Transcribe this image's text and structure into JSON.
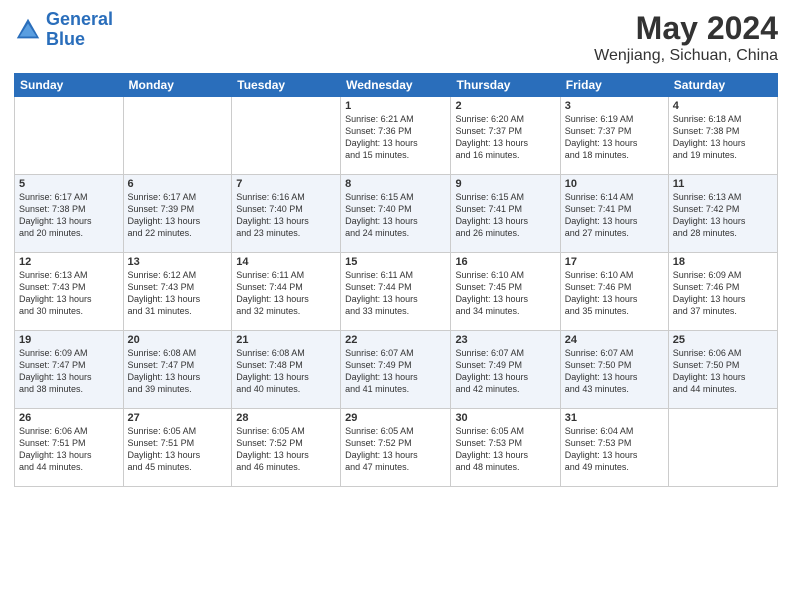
{
  "header": {
    "logo_line1": "General",
    "logo_line2": "Blue",
    "title": "May 2024",
    "subtitle": "Wenjiang, Sichuan, China"
  },
  "columns": [
    "Sunday",
    "Monday",
    "Tuesday",
    "Wednesday",
    "Thursday",
    "Friday",
    "Saturday"
  ],
  "weeks": [
    [
      {
        "day": "",
        "info": ""
      },
      {
        "day": "",
        "info": ""
      },
      {
        "day": "",
        "info": ""
      },
      {
        "day": "1",
        "info": "Sunrise: 6:21 AM\nSunset: 7:36 PM\nDaylight: 13 hours\nand 15 minutes."
      },
      {
        "day": "2",
        "info": "Sunrise: 6:20 AM\nSunset: 7:37 PM\nDaylight: 13 hours\nand 16 minutes."
      },
      {
        "day": "3",
        "info": "Sunrise: 6:19 AM\nSunset: 7:37 PM\nDaylight: 13 hours\nand 18 minutes."
      },
      {
        "day": "4",
        "info": "Sunrise: 6:18 AM\nSunset: 7:38 PM\nDaylight: 13 hours\nand 19 minutes."
      }
    ],
    [
      {
        "day": "5",
        "info": "Sunrise: 6:17 AM\nSunset: 7:38 PM\nDaylight: 13 hours\nand 20 minutes."
      },
      {
        "day": "6",
        "info": "Sunrise: 6:17 AM\nSunset: 7:39 PM\nDaylight: 13 hours\nand 22 minutes."
      },
      {
        "day": "7",
        "info": "Sunrise: 6:16 AM\nSunset: 7:40 PM\nDaylight: 13 hours\nand 23 minutes."
      },
      {
        "day": "8",
        "info": "Sunrise: 6:15 AM\nSunset: 7:40 PM\nDaylight: 13 hours\nand 24 minutes."
      },
      {
        "day": "9",
        "info": "Sunrise: 6:15 AM\nSunset: 7:41 PM\nDaylight: 13 hours\nand 26 minutes."
      },
      {
        "day": "10",
        "info": "Sunrise: 6:14 AM\nSunset: 7:41 PM\nDaylight: 13 hours\nand 27 minutes."
      },
      {
        "day": "11",
        "info": "Sunrise: 6:13 AM\nSunset: 7:42 PM\nDaylight: 13 hours\nand 28 minutes."
      }
    ],
    [
      {
        "day": "12",
        "info": "Sunrise: 6:13 AM\nSunset: 7:43 PM\nDaylight: 13 hours\nand 30 minutes."
      },
      {
        "day": "13",
        "info": "Sunrise: 6:12 AM\nSunset: 7:43 PM\nDaylight: 13 hours\nand 31 minutes."
      },
      {
        "day": "14",
        "info": "Sunrise: 6:11 AM\nSunset: 7:44 PM\nDaylight: 13 hours\nand 32 minutes."
      },
      {
        "day": "15",
        "info": "Sunrise: 6:11 AM\nSunset: 7:44 PM\nDaylight: 13 hours\nand 33 minutes."
      },
      {
        "day": "16",
        "info": "Sunrise: 6:10 AM\nSunset: 7:45 PM\nDaylight: 13 hours\nand 34 minutes."
      },
      {
        "day": "17",
        "info": "Sunrise: 6:10 AM\nSunset: 7:46 PM\nDaylight: 13 hours\nand 35 minutes."
      },
      {
        "day": "18",
        "info": "Sunrise: 6:09 AM\nSunset: 7:46 PM\nDaylight: 13 hours\nand 37 minutes."
      }
    ],
    [
      {
        "day": "19",
        "info": "Sunrise: 6:09 AM\nSunset: 7:47 PM\nDaylight: 13 hours\nand 38 minutes."
      },
      {
        "day": "20",
        "info": "Sunrise: 6:08 AM\nSunset: 7:47 PM\nDaylight: 13 hours\nand 39 minutes."
      },
      {
        "day": "21",
        "info": "Sunrise: 6:08 AM\nSunset: 7:48 PM\nDaylight: 13 hours\nand 40 minutes."
      },
      {
        "day": "22",
        "info": "Sunrise: 6:07 AM\nSunset: 7:49 PM\nDaylight: 13 hours\nand 41 minutes."
      },
      {
        "day": "23",
        "info": "Sunrise: 6:07 AM\nSunset: 7:49 PM\nDaylight: 13 hours\nand 42 minutes."
      },
      {
        "day": "24",
        "info": "Sunrise: 6:07 AM\nSunset: 7:50 PM\nDaylight: 13 hours\nand 43 minutes."
      },
      {
        "day": "25",
        "info": "Sunrise: 6:06 AM\nSunset: 7:50 PM\nDaylight: 13 hours\nand 44 minutes."
      }
    ],
    [
      {
        "day": "26",
        "info": "Sunrise: 6:06 AM\nSunset: 7:51 PM\nDaylight: 13 hours\nand 44 minutes."
      },
      {
        "day": "27",
        "info": "Sunrise: 6:05 AM\nSunset: 7:51 PM\nDaylight: 13 hours\nand 45 minutes."
      },
      {
        "day": "28",
        "info": "Sunrise: 6:05 AM\nSunset: 7:52 PM\nDaylight: 13 hours\nand 46 minutes."
      },
      {
        "day": "29",
        "info": "Sunrise: 6:05 AM\nSunset: 7:52 PM\nDaylight: 13 hours\nand 47 minutes."
      },
      {
        "day": "30",
        "info": "Sunrise: 6:05 AM\nSunset: 7:53 PM\nDaylight: 13 hours\nand 48 minutes."
      },
      {
        "day": "31",
        "info": "Sunrise: 6:04 AM\nSunset: 7:53 PM\nDaylight: 13 hours\nand 49 minutes."
      },
      {
        "day": "",
        "info": ""
      }
    ]
  ]
}
